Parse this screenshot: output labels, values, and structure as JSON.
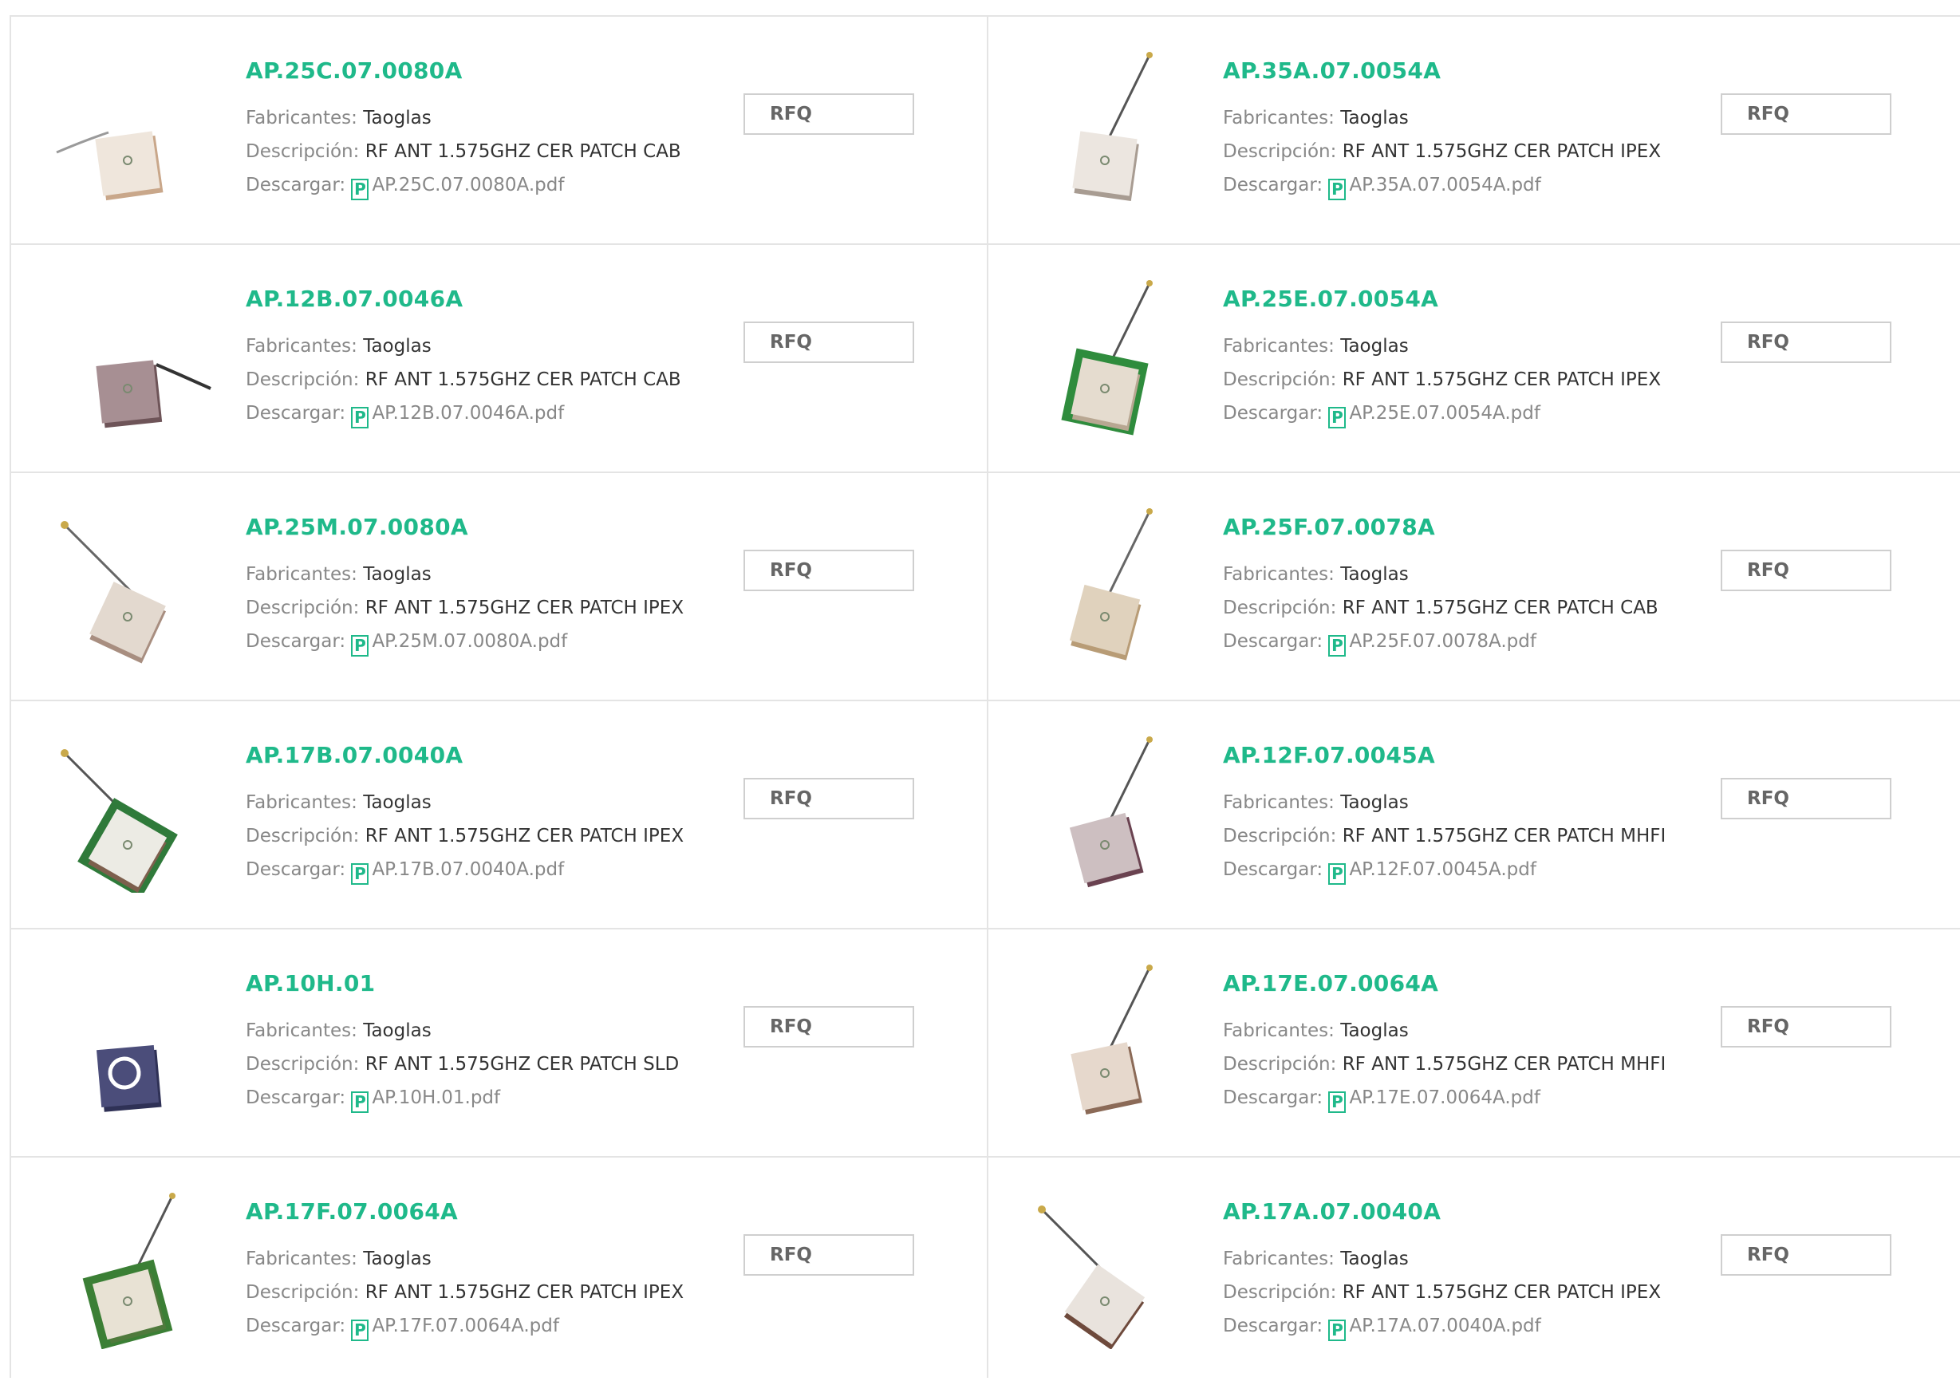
{
  "labels": {
    "manufacturer": "Fabricantes:",
    "description": "Descripción:",
    "download": "Descargar:",
    "rfq": "RFQ",
    "pdf_icon_glyph": "P"
  },
  "colors": {
    "accent": "#1fb98a",
    "border": "#e4e4e4"
  },
  "products": [
    {
      "part": "AP.25C.07.0080A",
      "manufacturer": "Taoglas",
      "description": "RF ANT 1.575GHZ CER PATCH CAB",
      "pdf": "AP.25C.07.0080A.pdf",
      "image": "ceramic-patch-antenna-cable-beige"
    },
    {
      "part": "AP.35A.07.0054A",
      "manufacturer": "Taoglas",
      "description": "RF ANT 1.575GHZ CER PATCH IPEX",
      "pdf": "AP.35A.07.0054A.pdf",
      "image": "ceramic-patch-antenna-ipex-large"
    },
    {
      "part": "AP.12B.07.0046A",
      "manufacturer": "Taoglas",
      "description": "RF ANT 1.575GHZ CER PATCH CAB",
      "pdf": "AP.12B.07.0046A.pdf",
      "image": "ceramic-patch-antenna-cable-brown"
    },
    {
      "part": "AP.25E.07.0054A",
      "manufacturer": "Taoglas",
      "description": "RF ANT 1.575GHZ CER PATCH IPEX",
      "pdf": "AP.25E.07.0054A.pdf",
      "image": "ceramic-patch-antenna-green-pcb"
    },
    {
      "part": "AP.25M.07.0080A",
      "manufacturer": "Taoglas",
      "description": "RF ANT 1.575GHZ CER PATCH IPEX",
      "pdf": "AP.25M.07.0080A.pdf",
      "image": "ceramic-patch-antenna-ipex-small"
    },
    {
      "part": "AP.25F.07.0078A",
      "manufacturer": "Taoglas",
      "description": "RF ANT 1.575GHZ CER PATCH CAB",
      "pdf": "AP.25F.07.0078A.pdf",
      "image": "ceramic-patch-antenna-cable-tan"
    },
    {
      "part": "AP.17B.07.0040A",
      "manufacturer": "Taoglas",
      "description": "RF ANT 1.575GHZ CER PATCH IPEX",
      "pdf": "AP.17B.07.0040A.pdf",
      "image": "ceramic-patch-antenna-green-pcb-large"
    },
    {
      "part": "AP.12F.07.0045A",
      "manufacturer": "Taoglas",
      "description": "RF ANT 1.575GHZ CER PATCH MHFI",
      "pdf": "AP.12F.07.0045A.pdf",
      "image": "ceramic-patch-antenna-mhfi-maroon"
    },
    {
      "part": "AP.10H.01",
      "manufacturer": "Taoglas",
      "description": "RF ANT 1.575GHZ CER PATCH SLD",
      "pdf": "AP.10H.01.pdf",
      "image": "ceramic-patch-antenna-shielded-blue"
    },
    {
      "part": "AP.17E.07.0064A",
      "manufacturer": "Taoglas",
      "description": "RF ANT 1.575GHZ CER PATCH MHFI",
      "pdf": "AP.17E.07.0064A.pdf",
      "image": "ceramic-patch-antenna-mhfi-brown"
    },
    {
      "part": "AP.17F.07.0064A",
      "manufacturer": "Taoglas",
      "description": "RF ANT 1.575GHZ CER PATCH IPEX",
      "pdf": "AP.17F.07.0064A.pdf",
      "image": "ceramic-patch-antenna-ipex-green"
    },
    {
      "part": "AP.17A.07.0040A",
      "manufacturer": "Taoglas",
      "description": "RF ANT 1.575GHZ CER PATCH IPEX",
      "pdf": "AP.17A.07.0040A.pdf",
      "image": "ceramic-patch-antenna-ipex-brown"
    }
  ]
}
